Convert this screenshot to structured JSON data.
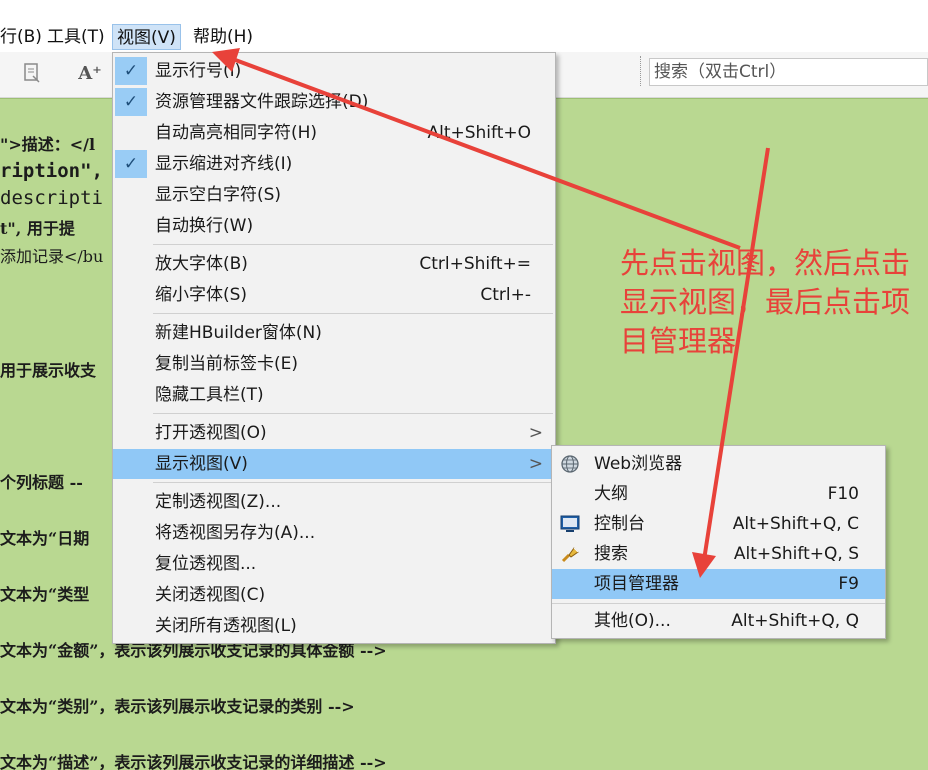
{
  "menubar": {
    "items": [
      "行(B)",
      "工具(T)",
      "视图(V)",
      "帮助(H)"
    ]
  },
  "toolbar": {
    "search_placeholder": "搜索（双击Ctrl）",
    "font_icon_glyph": "A⁺"
  },
  "editor": {
    "lines": [
      "\">描述：</l",
      "ription\",",
      "descripti",
      "t\", 用于提",
      "添加记录</bu",
      "用于展示收支",
      "个列标题 --",
      "文本为“日期",
      "文本为“类型",
      "文本为“金额”，表示该列展示收支记录的具体金额 -->",
      "文本为“类别”，表示该列展示收支记录的类别 -->",
      "文本为“描述”，表示该列展示收支记录的详细描述 -->"
    ]
  },
  "view_menu": {
    "items": [
      {
        "label": "显示行号(I)",
        "checked": true,
        "shortcut": ""
      },
      {
        "label": "资源管理器文件跟踪选择(D)",
        "checked": true,
        "shortcut": ""
      },
      {
        "label": "自动高亮相同字符(H)",
        "checked": false,
        "shortcut": "Alt+Shift+O"
      },
      {
        "label": "显示缩进对齐线(I)",
        "checked": true,
        "shortcut": ""
      },
      {
        "label": "显示空白字符(S)",
        "checked": false,
        "shortcut": ""
      },
      {
        "label": "自动换行(W)",
        "checked": false,
        "shortcut": ""
      },
      {
        "label": "放大字体(B)",
        "checked": false,
        "shortcut": "Ctrl+Shift+="
      },
      {
        "label": "缩小字体(S)",
        "checked": false,
        "shortcut": "Ctrl+-"
      },
      {
        "label": "新建HBuilder窗体(N)",
        "checked": false,
        "shortcut": ""
      },
      {
        "label": "复制当前标签卡(E)",
        "checked": false,
        "shortcut": ""
      },
      {
        "label": "隐藏工具栏(T)",
        "checked": false,
        "shortcut": ""
      },
      {
        "label": "打开透视图(O)",
        "checked": false,
        "shortcut": "",
        "submenu": true
      },
      {
        "label": "显示视图(V)",
        "checked": false,
        "shortcut": "",
        "submenu": true,
        "highlighted": true
      },
      {
        "label": "定制透视图(Z)...",
        "checked": false,
        "shortcut": ""
      },
      {
        "label": "将透视图另存为(A)...",
        "checked": false,
        "shortcut": ""
      },
      {
        "label": "复位透视图...",
        "checked": false,
        "shortcut": ""
      },
      {
        "label": "关闭透视图(C)",
        "checked": false,
        "shortcut": ""
      },
      {
        "label": "关闭所有透视图(L)",
        "checked": false,
        "shortcut": ""
      }
    ],
    "check_glyph": "✓",
    "submenu_arrow": ">"
  },
  "show_view_submenu": {
    "items": [
      {
        "label": "Web浏览器",
        "shortcut": "",
        "icon": "globe-icon"
      },
      {
        "label": "大纲",
        "shortcut": "F10",
        "icon": ""
      },
      {
        "label": "控制台",
        "shortcut": "Alt+Shift+Q, C",
        "icon": "console-icon"
      },
      {
        "label": "搜索",
        "shortcut": "Alt+Shift+Q, S",
        "icon": "search-flashlight-icon"
      },
      {
        "label": "项目管理器",
        "shortcut": "F9",
        "icon": "",
        "highlighted": true
      },
      {
        "label": "其他(O)...",
        "shortcut": "Alt+Shift+Q, Q",
        "icon": ""
      }
    ]
  },
  "annotation": {
    "text": "先点击视图，然后点击显示视图，最后点击项目管理器",
    "color": "#e8423a"
  },
  "colors": {
    "editor_bg": "#b9d891",
    "menu_highlight": "#90c8f6",
    "menu_bg": "#f2f2f2"
  }
}
